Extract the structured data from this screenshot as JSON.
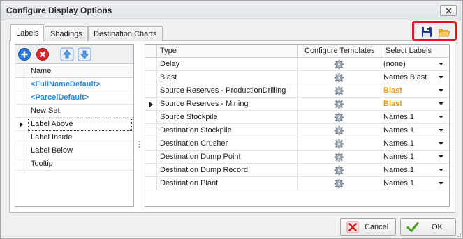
{
  "window": {
    "title": "Configure Display Options"
  },
  "tabs": [
    {
      "label": "Labels",
      "active": true
    },
    {
      "label": "Shadings",
      "active": false
    },
    {
      "label": "Destination Charts",
      "active": false
    }
  ],
  "toolbar_icons": [
    "save-icon",
    "open-folder-icon"
  ],
  "highlight_color": "#e8141c",
  "label_list": {
    "header": "Name",
    "rows": [
      {
        "text": "<FullNameDefault>",
        "style": "blue"
      },
      {
        "text": "<ParcelDefault>",
        "style": "blue"
      },
      {
        "text": "New Set",
        "style": "normal"
      },
      {
        "text": "Label Above",
        "style": "current"
      },
      {
        "text": "Label Inside",
        "style": "normal"
      },
      {
        "text": "Label Below",
        "style": "normal"
      },
      {
        "text": "Tooltip",
        "style": "normal"
      }
    ]
  },
  "grid": {
    "columns": [
      "Type",
      "Configure Templates",
      "Select Labels"
    ],
    "rows": [
      {
        "type": "Delay",
        "label": "(none)",
        "orange": false
      },
      {
        "type": "Blast",
        "label": "Names.Blast",
        "orange": false
      },
      {
        "type": "Source Reserves - ProductionDrilling",
        "label": "Blast",
        "orange": true
      },
      {
        "type": "Source Reserves - Mining",
        "label": "Blast",
        "orange": true,
        "current": true
      },
      {
        "type": "Source Stockpile",
        "label": "Names.1",
        "orange": false
      },
      {
        "type": "Destination Stockpile",
        "label": "Names.1",
        "orange": false
      },
      {
        "type": "Destination Crusher",
        "label": "Names.1",
        "orange": false
      },
      {
        "type": "Destination Dump Point",
        "label": "Names.1",
        "orange": false
      },
      {
        "type": "Destination Dump Record",
        "label": "Names.1",
        "orange": false
      },
      {
        "type": "Destination Plant",
        "label": "Names.1",
        "orange": false
      }
    ]
  },
  "footer": {
    "cancel_label": "Cancel",
    "ok_label": "OK"
  },
  "colors": {
    "blue_label": "#2a8ae0",
    "orange_label": "#f0960f"
  }
}
